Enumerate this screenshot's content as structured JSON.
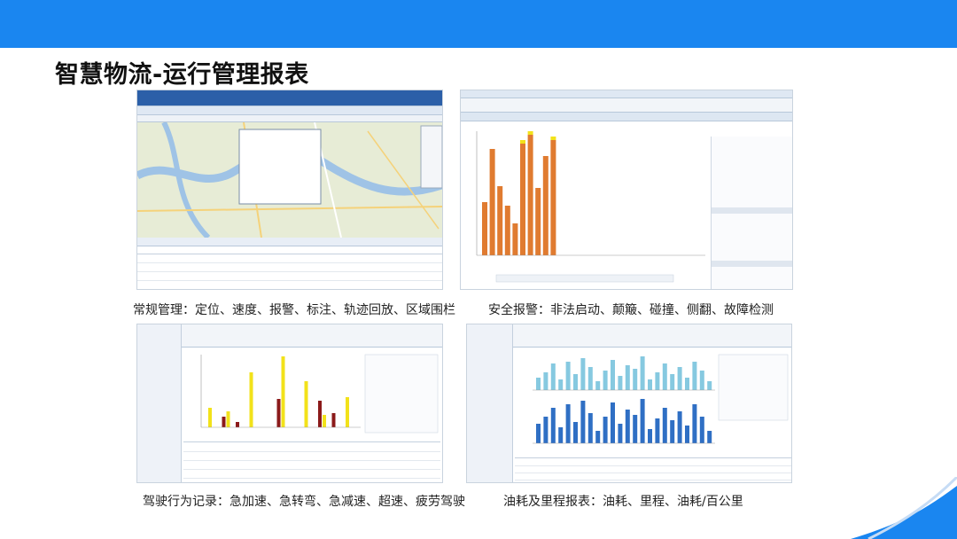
{
  "slide": {
    "title": "智慧物流-运行管理报表"
  },
  "panels": [
    {
      "caption": "常规管理：定位、速度、报警、标注、轨迹回放、区域围栏"
    },
    {
      "caption": "安全报警：非法启动、颠簸、碰撞、侧翻、故障检测"
    },
    {
      "caption": "驾驶行为记录：急加速、急转弯、急减速、超速、疲劳驾驶"
    },
    {
      "caption": "油耗及里程报表：油耗、里程、油耗/百公里"
    }
  ],
  "colors": {
    "banner": "#1a86f0",
    "bar_orange": "#e07b30",
    "bar_yellow": "#f2e21a",
    "bar_darkred": "#8b1a1a",
    "bar_lightblue": "#86c9e0",
    "bar_blue": "#2f6fc4"
  }
}
